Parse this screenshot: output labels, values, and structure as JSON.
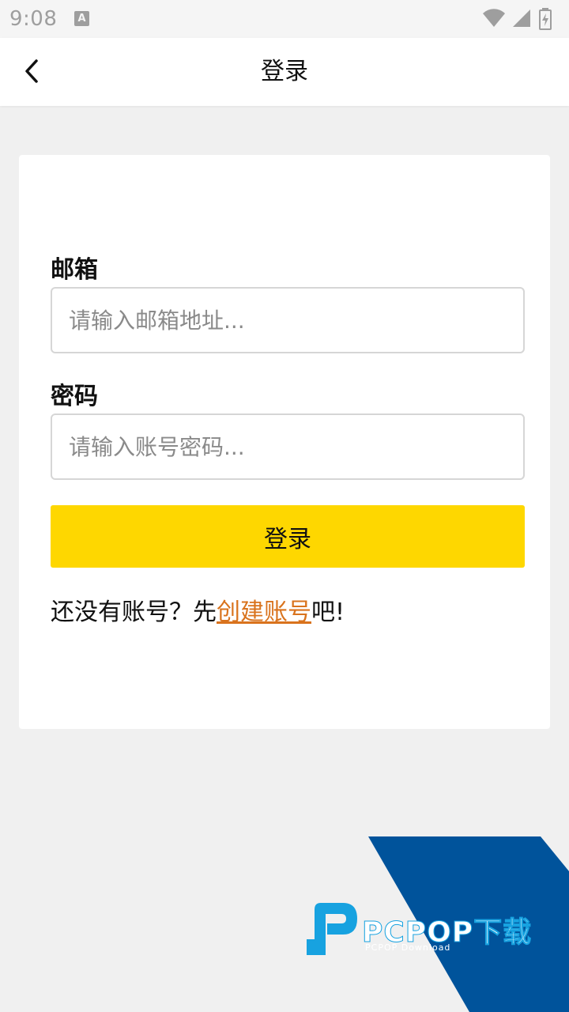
{
  "status_bar": {
    "time": "9:08",
    "notification_icon": "a-icon",
    "icons": [
      "wifi-icon",
      "signal-icon",
      "battery-icon"
    ]
  },
  "app_bar": {
    "title": "登录",
    "back_icon": "chevron-left-icon"
  },
  "form": {
    "email": {
      "label": "邮箱",
      "value": "",
      "placeholder": "请输入邮箱地址..."
    },
    "password": {
      "label": "密码",
      "value": "",
      "placeholder": "请输入账号密码..."
    },
    "login_button_label": "登录",
    "signup_prompt": {
      "prefix": "还没有账号？先",
      "link": "创建账号",
      "suffix": "吧!"
    }
  },
  "watermark": {
    "brand": "PCPOP下载",
    "subtitle": "PCPOP Download"
  },
  "colors": {
    "background": "#f0f0f0",
    "accent_button": "#fed700",
    "link": "#d9731d",
    "watermark_blue": "#00539b",
    "watermark_cyan": "#17a2e0"
  }
}
